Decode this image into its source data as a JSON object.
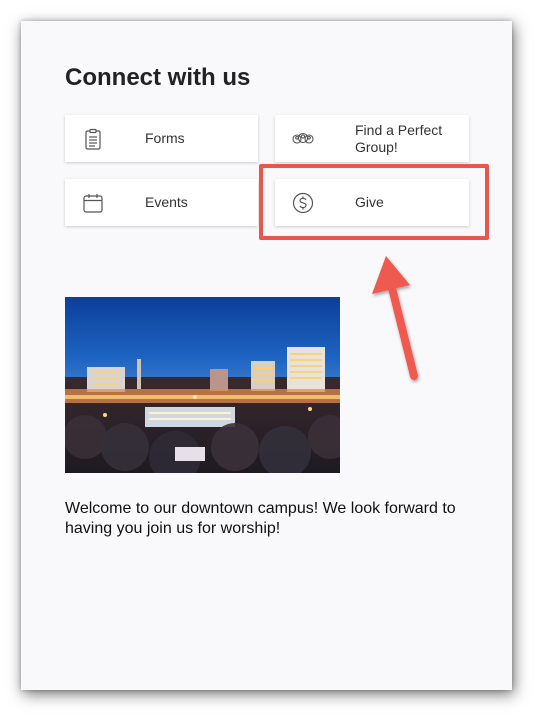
{
  "section": {
    "title": "Connect with us"
  },
  "tiles": [
    {
      "label": "Forms",
      "icon": "clipboard-icon"
    },
    {
      "label": "Find a Perfect Group!",
      "icon": "group-icon"
    },
    {
      "label": "Events",
      "icon": "calendar-icon"
    },
    {
      "label": "Give",
      "icon": "dollar-circle-icon"
    }
  ],
  "campus": {
    "image_alt": "downtown city skyline at dusk",
    "welcome": "Welcome to our downtown campus!  We look forward to having you join us for worship!"
  },
  "annotation": {
    "color": "#e9564d"
  }
}
